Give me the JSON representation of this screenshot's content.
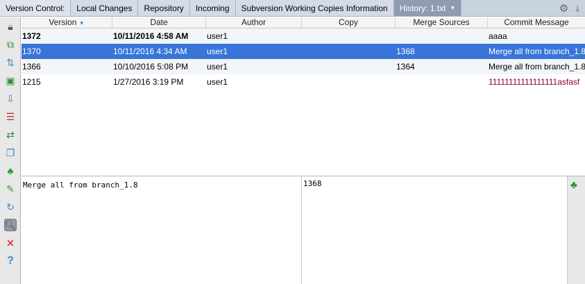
{
  "tabs": {
    "label": "Version Control:",
    "items": [
      "Local Changes",
      "Repository",
      "Incoming",
      "Subversion Working Copies Information",
      "History: 1.txt"
    ]
  },
  "icons": [
    "lock-icon",
    "copy-icon",
    "align-icon",
    "file-diff-icon",
    "checkout-icon",
    "changelist-icon",
    "compare-icon",
    "copy-files-icon",
    "branch-tree-icon",
    "edit-icon",
    "refresh-icon",
    "find-icon",
    "close-icon",
    "help-icon"
  ],
  "table": {
    "columns": [
      "Version",
      "Date",
      "Author",
      "Copy",
      "Merge Sources",
      "Commit Message"
    ],
    "rows": [
      {
        "version": "1372",
        "date": "10/11/2016 4:58 AM",
        "author": "user1",
        "copy": "",
        "merge": "",
        "message": "aaaa"
      },
      {
        "version": "1370",
        "date": "10/11/2016 4:34 AM",
        "author": "user1",
        "copy": "",
        "merge": "1368",
        "message": "Merge all from branch_1.8"
      },
      {
        "version": "1366",
        "date": "10/10/2016 5:08 PM",
        "author": "user1",
        "copy": "",
        "merge": "1364",
        "message": "Merge all from branch_1.8"
      },
      {
        "version": "1215",
        "date": "1/27/2016 3:19 PM",
        "author": "user1",
        "copy": "",
        "merge": "",
        "message": "11111111111111111asfasf"
      }
    ]
  },
  "details": {
    "message": "Merge all from branch_1.8",
    "merge_sources": "1368"
  },
  "colors": {
    "selection": "#3875d7",
    "tab_active": "#8e9cb2"
  }
}
